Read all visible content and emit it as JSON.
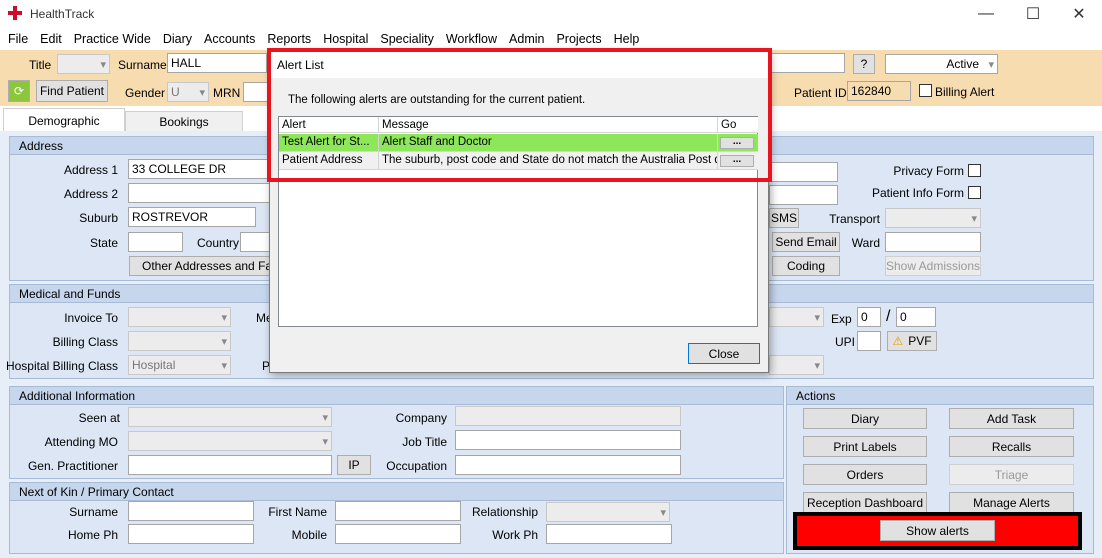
{
  "window": {
    "title": "HealthTrack",
    "minimize": "—",
    "maximize": "☐",
    "close": "✕"
  },
  "menu": [
    "File",
    "Edit",
    "Practice Wide",
    "Diary",
    "Accounts",
    "Reports",
    "Hospital",
    "Speciality",
    "Workflow",
    "Admin",
    "Projects",
    "Help"
  ],
  "header": {
    "title_label": "Title",
    "surname_label": "Surname",
    "surname_value": "HALL",
    "help_button": "?",
    "status_value": "Active",
    "find_patient": "Find Patient",
    "gender_label": "Gender",
    "gender_value": "U",
    "mrn_label": "MRN",
    "patient_id_label": "Patient ID",
    "patient_id_value": "162840",
    "billing_alert_label": "Billing Alert"
  },
  "tabs": [
    "Demographic",
    "Bookings"
  ],
  "address": {
    "title": "Address",
    "address1_label": "Address 1",
    "address1_value": "33 COLLEGE DR",
    "address2_label": "Address 2",
    "suburb_label": "Suburb",
    "suburb_value": "ROSTREVOR",
    "state_label": "State",
    "country_label": "Country",
    "other_addresses": "Other Addresses and Famil",
    "privacy_form_label": "Privacy Form",
    "patient_info_form_label": "Patient Info Form",
    "sms_button": "SMS",
    "transport_label": "Transport",
    "send_email_button": "Send Email",
    "ward_label": "Ward",
    "coding_button": "Coding",
    "show_admissions_button": "Show Admissions"
  },
  "medical": {
    "title": "Medical and Funds",
    "invoice_to_label": "Invoice To",
    "billing_class_label": "Billing Class",
    "hospital_billing_class_label": "Hospital Billing Class",
    "hospital_billing_class_value": "Hospital",
    "me_label_partial": "Me",
    "p_label_partial": "P",
    "exp_label": "Exp",
    "exp_month": "0",
    "exp_sep": "/",
    "exp_year": "0",
    "upi_label": "UPI",
    "pvf_button": "PVF"
  },
  "additional": {
    "title": "Additional Information",
    "seen_at_label": "Seen at",
    "attending_mo_label": "Attending MO",
    "gen_practitioner_label": "Gen. Practitioner",
    "ip_button": "IP",
    "company_label": "Company",
    "job_title_label": "Job Title",
    "occupation_label": "Occupation"
  },
  "kin": {
    "title": "Next of Kin / Primary Contact",
    "surname_label": "Surname",
    "first_name_label": "First Name",
    "relationship_label": "Relationship",
    "home_ph_label": "Home Ph",
    "mobile_label": "Mobile",
    "work_ph_label": "Work Ph"
  },
  "actions": {
    "title": "Actions",
    "diary": "Diary",
    "add_task": "Add Task",
    "print_labels": "Print Labels",
    "recalls": "Recalls",
    "orders": "Orders",
    "triage": "Triage",
    "reception_dashboard": "Reception Dashboard",
    "manage_alerts": "Manage Alerts",
    "show_alerts": "Show alerts"
  },
  "alert_dialog": {
    "title": "Alert List",
    "message": "The following alerts are outstanding for the current patient.",
    "columns": [
      "Alert",
      "Message",
      "Go"
    ],
    "rows": [
      {
        "alert": "Test Alert for St...",
        "message": "Alert Staff and Doctor",
        "go": "..."
      },
      {
        "alert": "Patient Address",
        "message": "The suburb, post code and State do not match the Australia Post d...",
        "go": "..."
      }
    ],
    "close_button": "Close"
  },
  "colors": {
    "header_band": "#f7dcb0",
    "highlight_row": "#8ee65a",
    "alert_red": "#e8141e"
  }
}
